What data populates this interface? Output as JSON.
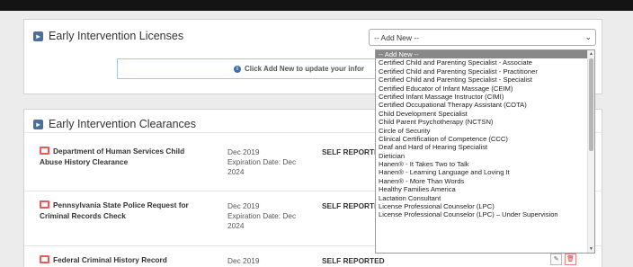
{
  "licenses": {
    "title": "Early Intervention Licenses",
    "select_value": "-- Add New --",
    "info_text": "Click Add New to update your infor"
  },
  "clearances": {
    "title": "Early Intervention Clearances",
    "rows": [
      {
        "title": "Department of Human Services Child Abuse History Clearance",
        "date": "Dec 2019",
        "expiration": "Expiration Date: Dec 2024",
        "status": "SELF REPORTE"
      },
      {
        "title": "Pennsylvania State Police Request for Criminal Records Check",
        "date": "Dec 2019",
        "expiration": "Expiration Date: Dec 2024",
        "status": "SELF REPORTE"
      },
      {
        "title": "Federal Criminal History Record Information",
        "date": "Dec 2019",
        "status": "SELF REPORTED"
      }
    ]
  },
  "dropdown": {
    "options": [
      "-- Add New --",
      "Certified Child and Parenting Specialist - Associate",
      "Certified Child and Parenting Specialist - Practitioner",
      "Certified Child and Parenting Specialist - Specialist",
      "Certified Educator of Infant Massage (CEIM)",
      "Certified Infant Massage Instructor (CIMI)",
      "Certified Occupational Therapy Assistant (COTA)",
      "Child Development Specialist",
      "Child Parent Psychotherapy (NCTSN)",
      "Circle of Security",
      "Clinical Certification of Competence (CCC)",
      "Deaf and Hard of Hearing Specialist",
      "Dietician",
      "Hanen® - It Takes Two to Talk",
      "Hanen® - Learning Language and Loving It",
      "Hanen® - More Than Words",
      "Healthy Families America",
      "Lactation Consultant",
      "License Professional Counselor (LPC)",
      "License Professional Counselor (LPC) – Under Supervision"
    ]
  }
}
